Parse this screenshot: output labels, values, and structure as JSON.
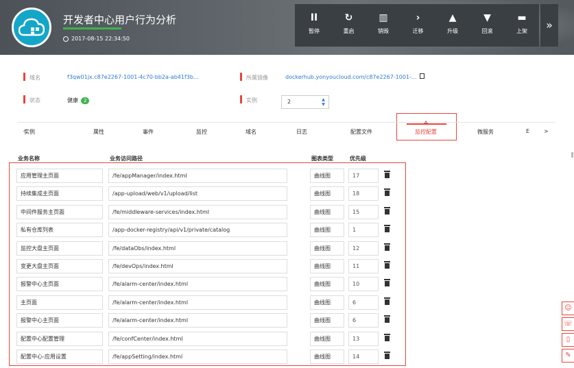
{
  "app": {
    "title": "开发者中心用户行为分析",
    "timestamp": "2017-08-15 22:34:50",
    "progress": 1.0
  },
  "actions": [
    {
      "icon": "pause-icon",
      "glyph": "II",
      "label": "暂停"
    },
    {
      "icon": "restart-icon",
      "glyph": "↻",
      "label": "重启"
    },
    {
      "icon": "destroy-icon",
      "glyph": "▥",
      "label": "销毁"
    },
    {
      "icon": "migrate-icon",
      "glyph": "›",
      "label": "迁移"
    },
    {
      "icon": "upgrade-icon",
      "glyph": "▲",
      "label": "升级"
    },
    {
      "icon": "rollback-icon",
      "glyph": "▼",
      "label": "回滚"
    },
    {
      "icon": "publish-icon",
      "glyph": "▬",
      "label": "上架"
    }
  ],
  "more_glyph": "»",
  "info": {
    "domain_label": "域名",
    "domain_value": "f3qw01jx.c87e2267-1001-4c70-bb2a-ab41f3b...",
    "image_label": "所属镜像",
    "image_value": "dockerhub.yonyoucloud.com/c87e2267-1001-...",
    "status_label": "状态",
    "status_value": "健康",
    "status_badge": "2",
    "instance_label": "实例",
    "instance_value": "2"
  },
  "tabs": {
    "prev": "<",
    "items": [
      "实例",
      "属性",
      "事件",
      "监控",
      "域名",
      "日志",
      "配置文件",
      "监控配置",
      "微服务",
      "E"
    ],
    "active": "监控配置",
    "next": ">"
  },
  "table": {
    "headers": [
      "业务名称",
      "业务访问路径",
      "图表类型",
      "优先级"
    ],
    "rows": [
      {
        "name": "应用管理主页面",
        "path": "/fe/appManager/index.html",
        "type": "曲线图",
        "priority": "17"
      },
      {
        "name": "持续集成主页面",
        "path": "/app-upload/web/v1/upload/list",
        "type": "曲线图",
        "priority": "18"
      },
      {
        "name": "中间件服务主页面",
        "path": "/fe/middleware-services/index.html",
        "type": "曲线图",
        "priority": "15"
      },
      {
        "name": "私有仓库列表",
        "path": "/app-docker-registry/api/v1/private/catalog",
        "type": "曲线图",
        "priority": "1"
      },
      {
        "name": "监控大盘主页面",
        "path": "/fe/dataObs/index.html",
        "type": "曲线图",
        "priority": "12"
      },
      {
        "name": "变更大盘主页面",
        "path": "/fe/devOps/index.html",
        "type": "曲线图",
        "priority": "11"
      },
      {
        "name": "报警中心主页面",
        "path": "/fe/alarm-center/index.html",
        "type": "曲线图",
        "priority": "10"
      },
      {
        "name": "主页面",
        "path": "/fe/alarm-center/index.html",
        "type": "曲线图",
        "priority": "6"
      },
      {
        "name": "报警中心主页面",
        "path": "/fe/alarm-center/index.html",
        "type": "曲线图",
        "priority": "6"
      },
      {
        "name": "配置中心配置管理",
        "path": "/fe/confCenter/index.html",
        "type": "曲线图",
        "priority": "13"
      },
      {
        "name": "配置中心-应用设置",
        "path": "/fe/appSetting/index.html",
        "type": "曲线图",
        "priority": "14"
      }
    ]
  },
  "side_tools": [
    {
      "icon": "robot-icon",
      "glyph": "☺"
    },
    {
      "icon": "phone-icon",
      "glyph": "☏"
    },
    {
      "icon": "mobile-icon",
      "glyph": "▯"
    },
    {
      "icon": "feedback-icon",
      "glyph": "✎"
    }
  ],
  "colors": {
    "accent": "#e8453c",
    "link": "#2b7bd3",
    "healthy": "#3fb34f",
    "logo": "#13a6c9"
  }
}
